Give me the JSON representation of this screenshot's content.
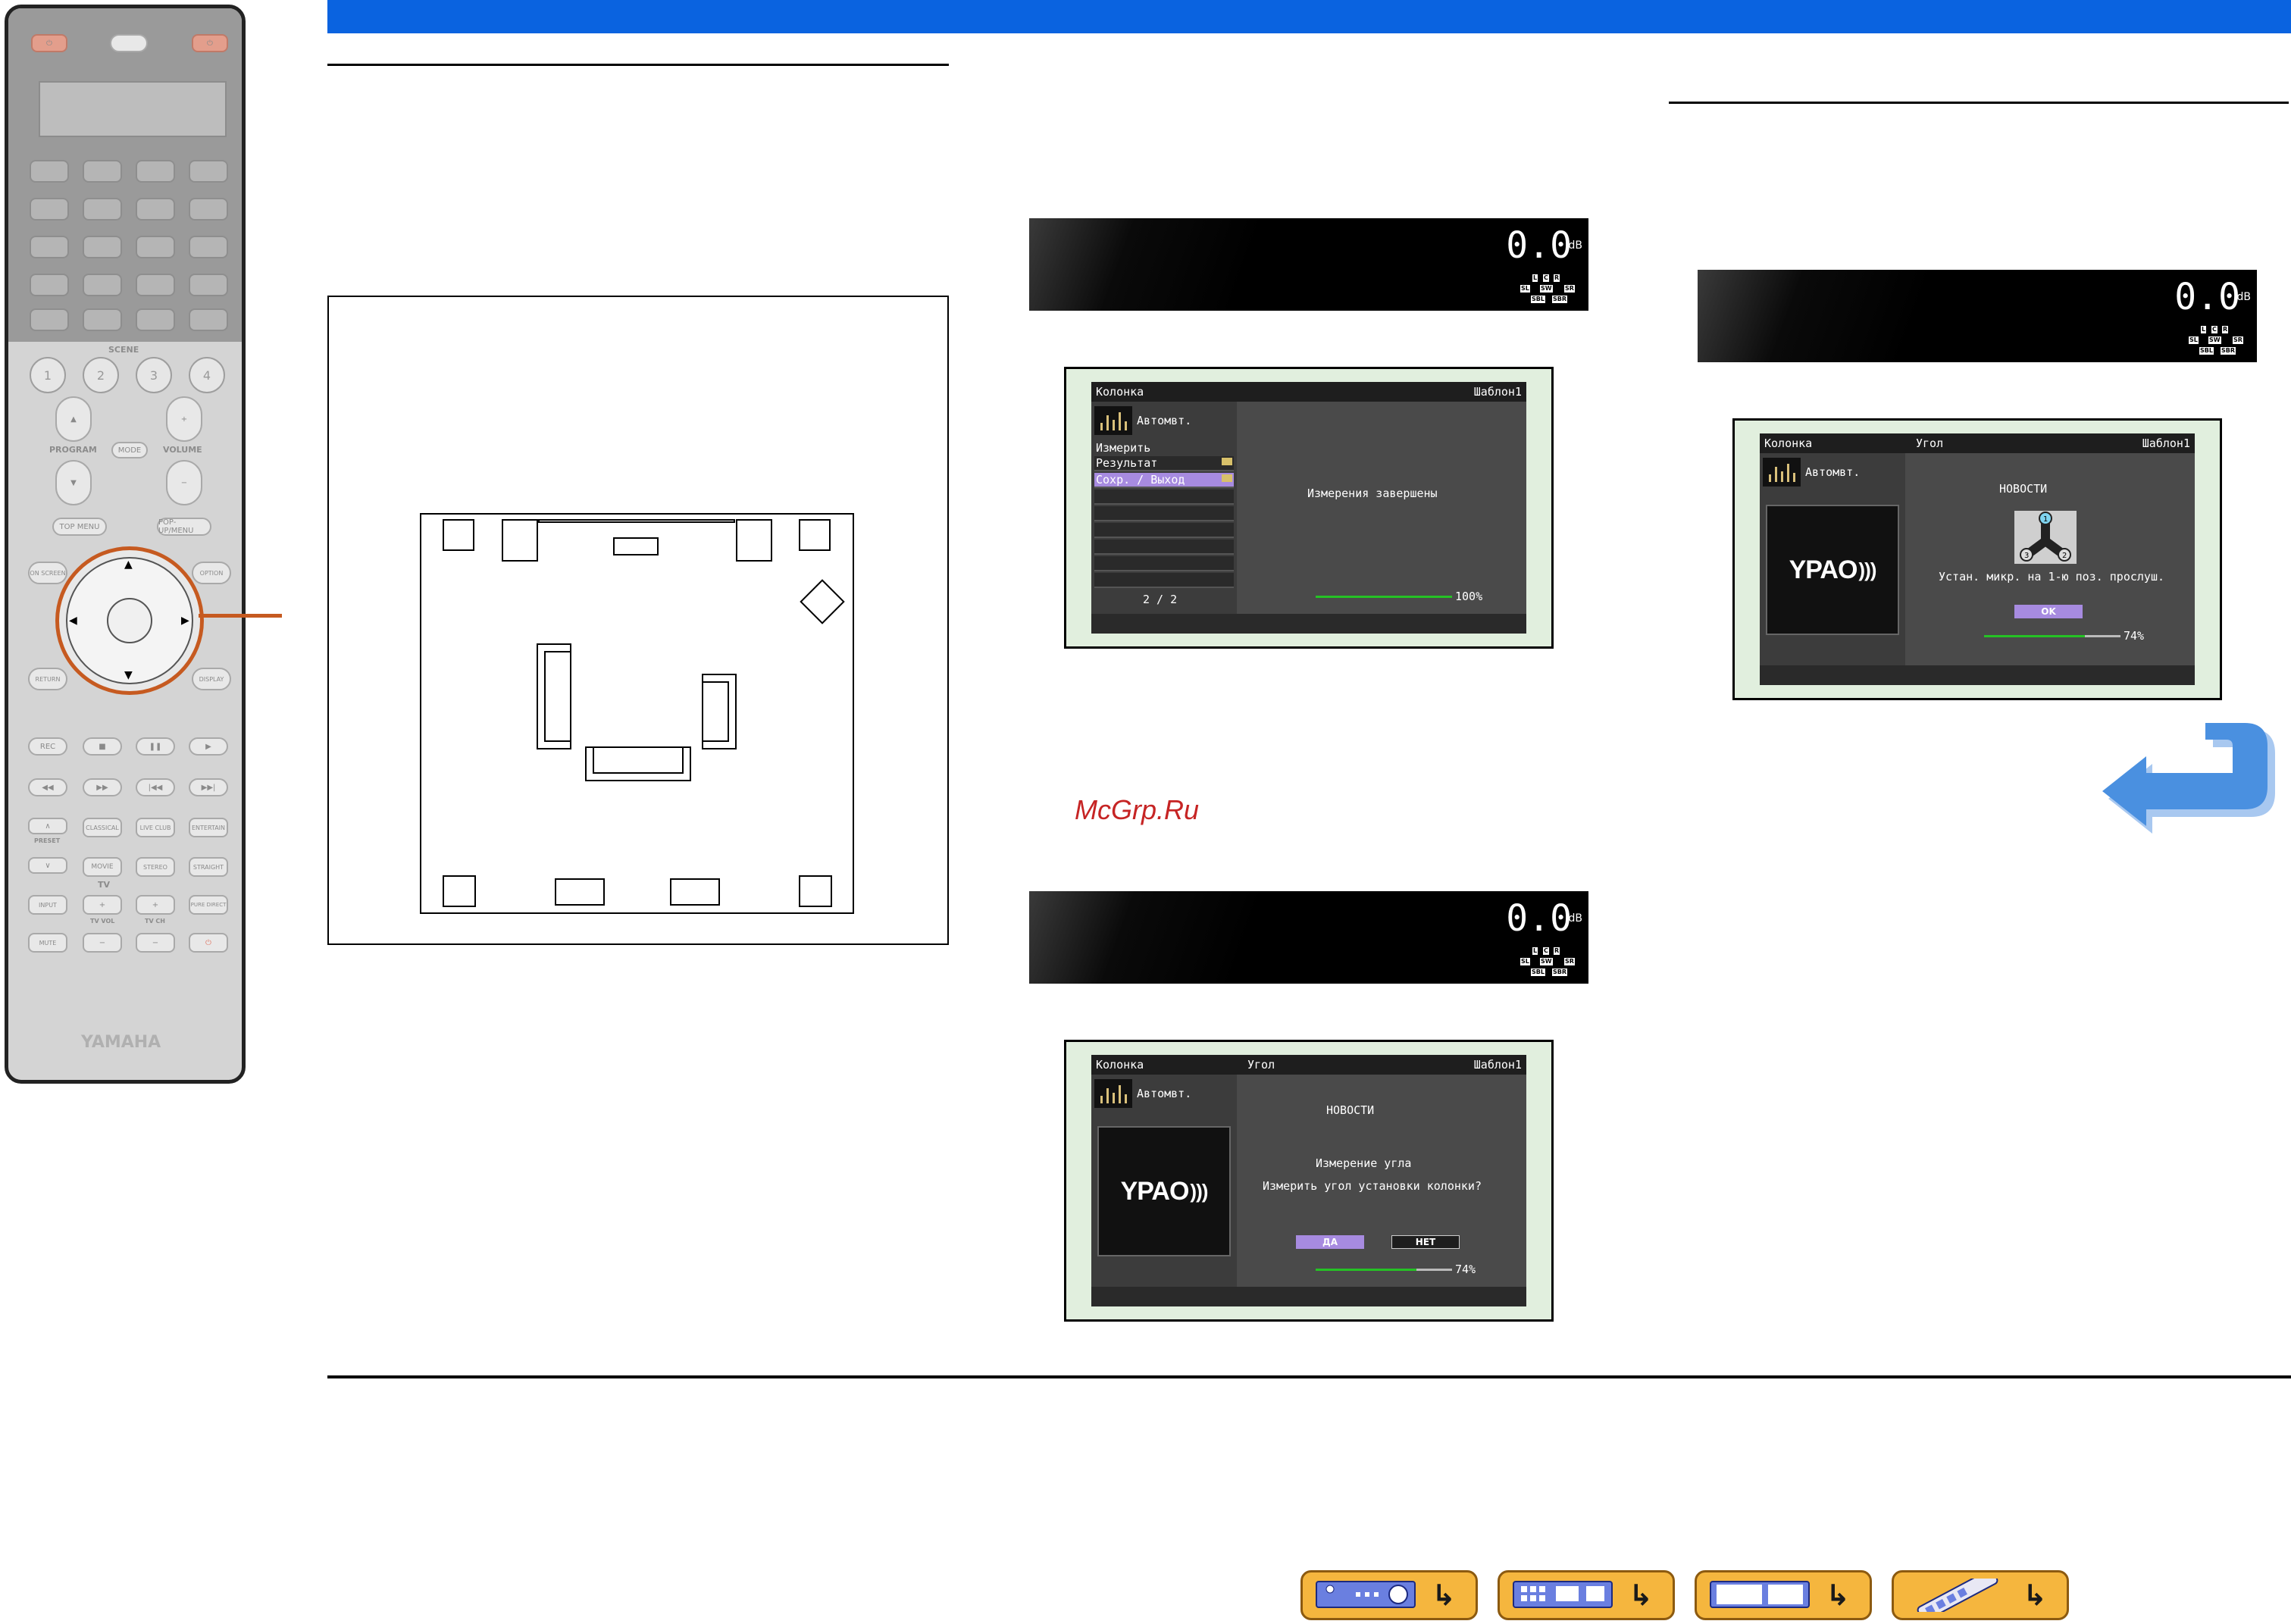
{
  "remote": {
    "scene_label": "SCENE",
    "scene_buttons": [
      "1",
      "2",
      "3",
      "4"
    ],
    "program_label": "PROGRAM",
    "mode_label": "MODE",
    "volume_label": "VOLUME",
    "top_menu": "TOP MENU",
    "popup_menu": "POP-UP/MENU",
    "on_screen": "ON SCREEN",
    "option": "OPTION",
    "return": "RETURN",
    "display": "DISPLAY",
    "rec": "REC",
    "preset_label": "PRESET",
    "classical": "CLASSICAL",
    "live_club": "LIVE CLUB",
    "entertain": "ENTERTAIN",
    "movie": "MOVIE",
    "stereo": "STEREO",
    "straight": "STRAIGHT",
    "tv_label": "TV",
    "input": "INPUT",
    "pure_direct": "PURE DIRECT",
    "tv_vol": "TV VOL",
    "tv_ch": "TV CH",
    "mute": "MUTE",
    "brand": "YAMAHA"
  },
  "front_display": {
    "level": "0.0",
    "unit": "dB",
    "channels": [
      "L",
      "C",
      "R",
      "SL",
      "SW",
      "SR",
      "SBL",
      "SBR"
    ]
  },
  "osd_result": {
    "header_left": "Колонка",
    "header_right": "Шаблон1",
    "mode": "Автомвт.",
    "menu_title": "Измерить",
    "menu_items": [
      "Результат",
      "Сохр. / Выход"
    ],
    "page": "2 / 2",
    "message": "Измерения завершены",
    "progress_label": "100%",
    "progress": 1.0
  },
  "osd_angle_question": {
    "header_left": "Колонка",
    "header_mid": "Угол",
    "header_right": "Шаблон1",
    "mode": "Автомвт.",
    "logo": "YPAO",
    "news": "НОВОСТИ",
    "line1": "Измерение угла",
    "line2": "Измерить угол установки колонки?",
    "yes": "ДА",
    "no": "НЕТ",
    "progress_label": "74%",
    "progress": 0.74
  },
  "osd_angle_mic": {
    "header_left": "Колонка",
    "header_mid": "Угол",
    "header_right": "Шаблон1",
    "mode": "Автомвт.",
    "logo": "YPAO",
    "news": "НОВОСТИ",
    "line1": "Устан. микр. на 1-ю поз. прослуш.",
    "mic_positions": [
      "1",
      "2",
      "3"
    ],
    "ok": "OK",
    "progress_label": "74%",
    "progress": 0.74
  },
  "watermark": "McGrp.Ru",
  "colors": {
    "header_blue": "#0a63e0",
    "callout_orange": "#c65a20",
    "osd_selected": "#a78be0",
    "progress_green": "#25c225",
    "nav_orange": "#f5b63e",
    "return_arrow_blue": "#4a90e0"
  },
  "nav_buttons": [
    {
      "icon": "receiver-front-icon"
    },
    {
      "icon": "receiver-rear-icon"
    },
    {
      "icon": "remote-buttons-icon"
    },
    {
      "icon": "remote-control-icon"
    }
  ]
}
